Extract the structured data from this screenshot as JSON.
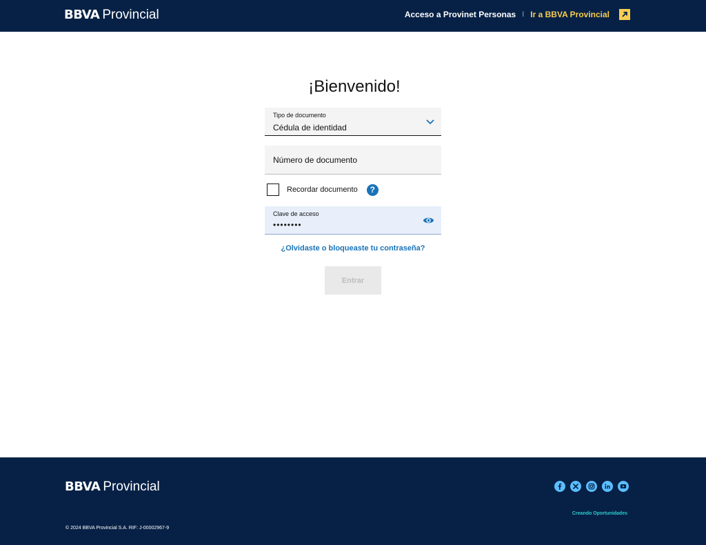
{
  "brand": {
    "bank": "BBVA",
    "name": "Provincial"
  },
  "header": {
    "link_personas": "Acceso a Provinet Personas",
    "separator": "I",
    "link_bbva": "Ir a BBVA Provincial",
    "ext_icon": "arrow-up-right-icon"
  },
  "form": {
    "title": "¡Bienvenido!",
    "doc_type": {
      "label": "Tipo de documento",
      "value": "Cédula de identidad"
    },
    "doc_number": {
      "placeholder": "Número de documento"
    },
    "remember": {
      "label": "Recordar documento",
      "checked": false
    },
    "password": {
      "label": "Clave de acceso",
      "value": "••••••••"
    },
    "forgot_link": "¿Olvidaste o bloqueaste tu contraseña?",
    "submit_label": "Entrar"
  },
  "footer": {
    "socials": [
      "facebook-icon",
      "x-icon",
      "instagram-icon",
      "linkedin-icon",
      "youtube-icon"
    ],
    "tagline": "Creando Oportunidades",
    "copyright": "© 2024 BBVA Provincial S.A. RIF: J-00002967-9"
  },
  "colors": {
    "navy": "#072146",
    "accent_blue": "#1973b8",
    "yellow": "#f8cd51",
    "aqua": "#2dcccd",
    "social_blue": "#5bbeff"
  }
}
